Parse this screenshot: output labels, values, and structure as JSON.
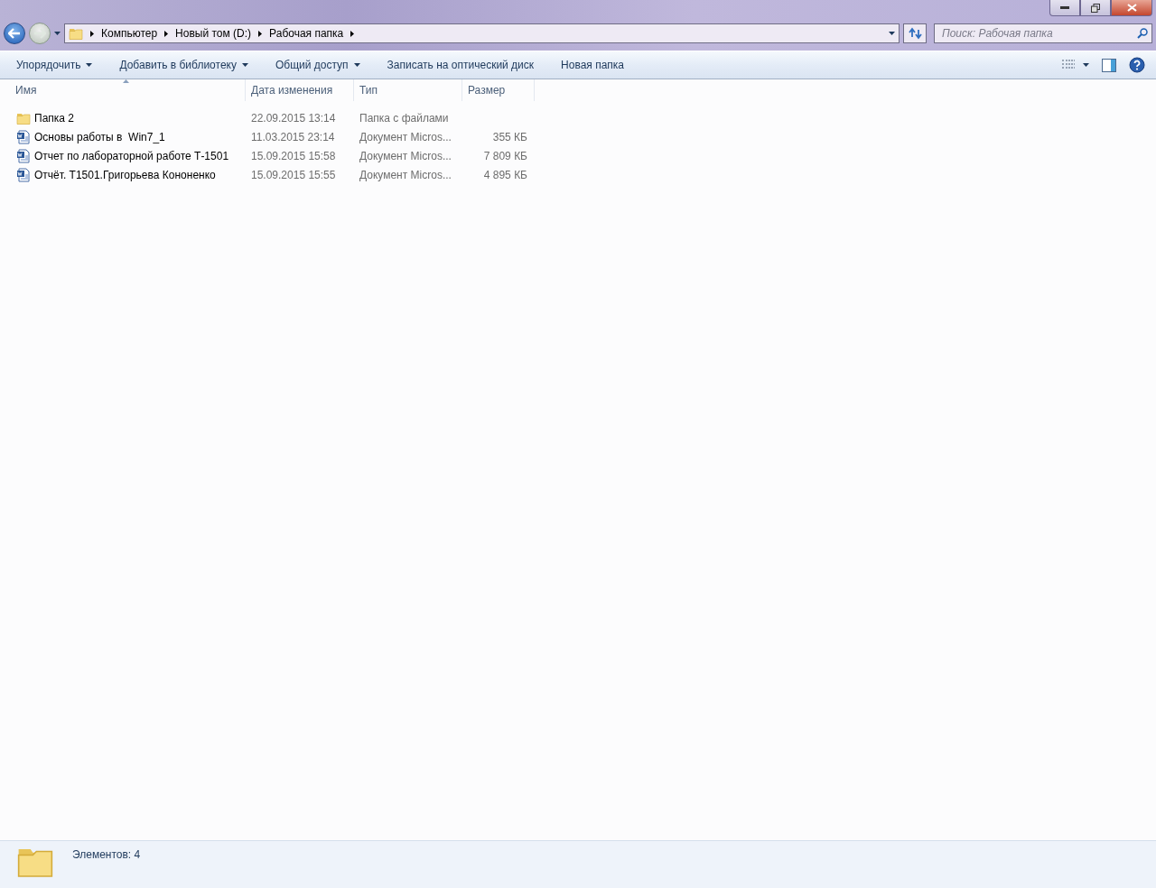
{
  "address_bar": {
    "segments": [
      "Компьютер",
      "Новый том (D:)",
      "Рабочая папка"
    ]
  },
  "search": {
    "placeholder": "Поиск: Рабочая папка"
  },
  "toolbar": [
    {
      "label": "Упорядочить",
      "dropdown": true
    },
    {
      "label": "Добавить в библиотеку",
      "dropdown": true
    },
    {
      "label": "Общий доступ",
      "dropdown": true
    },
    {
      "label": "Записать на оптический диск",
      "dropdown": false
    },
    {
      "label": "Новая папка",
      "dropdown": false
    }
  ],
  "table": {
    "columns": [
      {
        "label": "Имя",
        "sorted": true
      },
      {
        "label": "Дата изменения",
        "sorted": false
      },
      {
        "label": "Тип",
        "sorted": false
      },
      {
        "label": "Размер",
        "sorted": false
      }
    ],
    "rows": [
      {
        "kind": "folder",
        "name": "Папка 2",
        "date": "22.09.2015 13:14",
        "type": "Папка с файлами"
      },
      {
        "kind": "document",
        "name": "Основы работы в  Win7_1",
        "date": "11.03.2015 23:14",
        "type": "Документ Micros...",
        "size": "355 КБ"
      },
      {
        "kind": "document",
        "name": "Отчет по лабораторной работе Т-1501",
        "date": "15.09.2015 15:58",
        "type": "Документ Micros...",
        "size": "7 809 КБ"
      },
      {
        "kind": "document",
        "name": "Отчёт. Т1501.Григорьева Кононенко",
        "date": "15.09.2015 15:55",
        "type": "Документ Micros...",
        "size": "4 895 КБ"
      }
    ]
  },
  "status_bar": {
    "text": "Элементов: 4"
  }
}
